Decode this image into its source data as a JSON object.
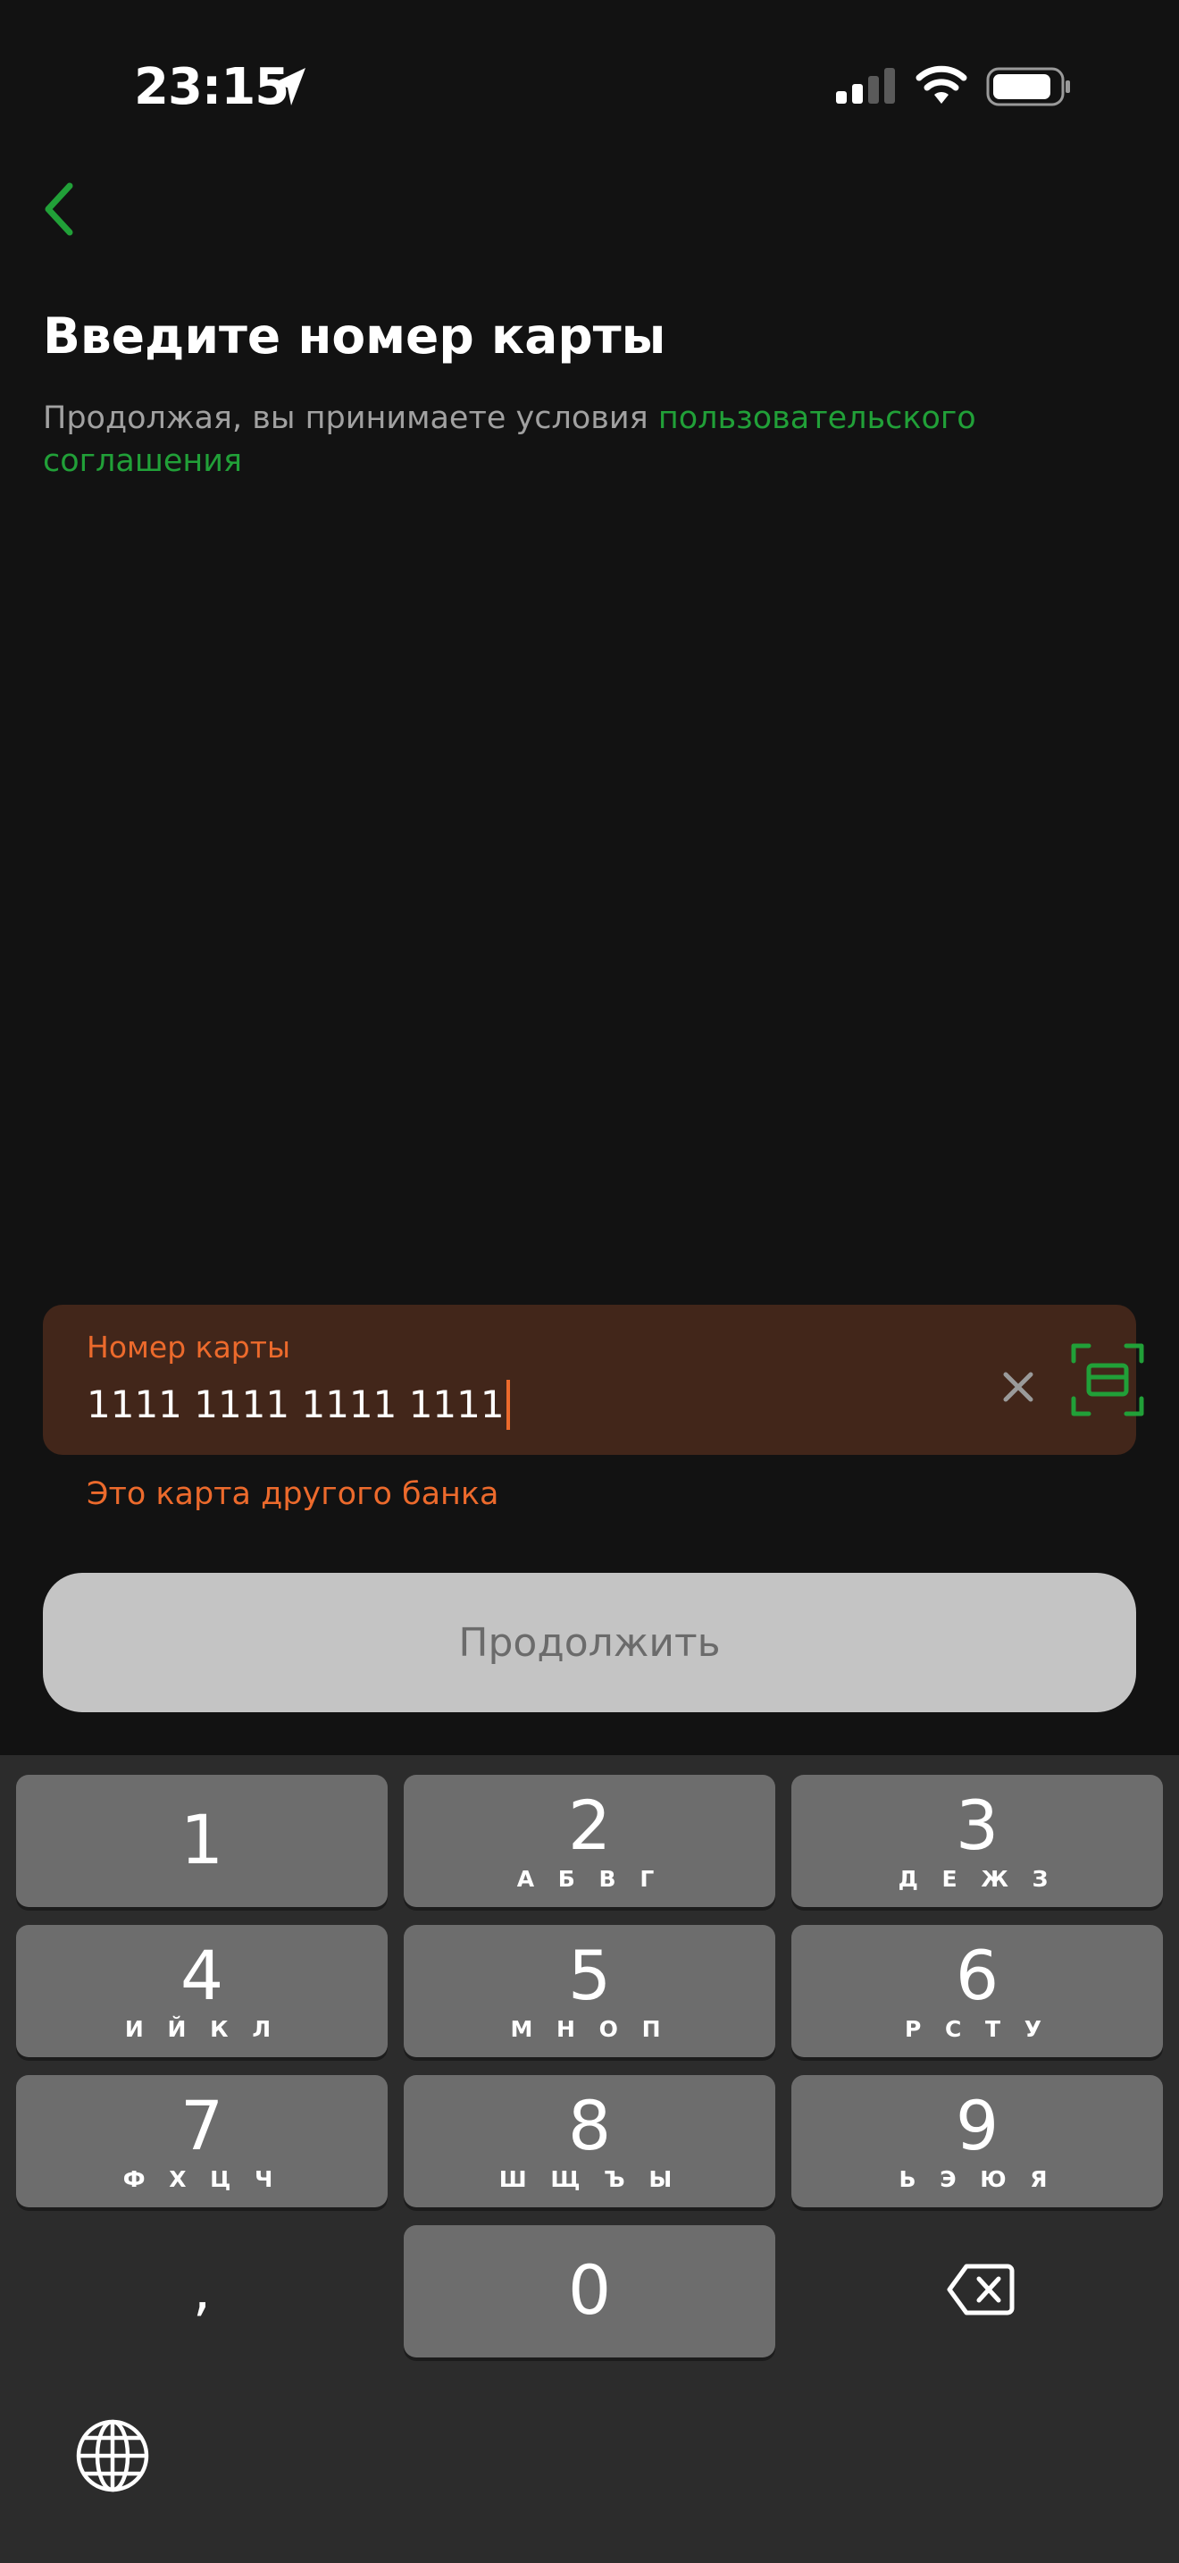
{
  "status_bar": {
    "time": "23:15",
    "icons": [
      "location-arrow-icon",
      "cellular-signal-icon",
      "wifi-icon",
      "battery-icon"
    ]
  },
  "header": {
    "back_icon": "chevron-left-icon",
    "title": "Введите номер карты"
  },
  "agreement": {
    "text": "Продолжая, вы принимаете условия ",
    "link": "пользовательского соглашения"
  },
  "card_input": {
    "label": "Номер карты",
    "value": "1111 1111 1111 1111",
    "error": "Это карта другого банка",
    "clear_icon": "close-icon",
    "scan_icon": "card-scan-icon"
  },
  "continue_button": {
    "label": "Продолжить"
  },
  "keyboard": {
    "keys": [
      {
        "digit": "1",
        "letters": ""
      },
      {
        "digit": "2",
        "letters": "А Б В Г"
      },
      {
        "digit": "3",
        "letters": "Д Е Ж З"
      },
      {
        "digit": "4",
        "letters": "И Й К Л"
      },
      {
        "digit": "5",
        "letters": "М Н О П"
      },
      {
        "digit": "6",
        "letters": "Р С Т У"
      },
      {
        "digit": "7",
        "letters": "Ф Х Ц Ч"
      },
      {
        "digit": "8",
        "letters": "Ш Щ Ъ Ы"
      },
      {
        "digit": "9",
        "letters": "Ь Э Ю Я"
      },
      {
        "digit": "0",
        "letters": ""
      }
    ],
    "comma": ",",
    "backspace_icon": "backspace-icon",
    "globe_icon": "globe-icon"
  },
  "colors": {
    "background": "#121212",
    "accent_green": "#21a038",
    "error_orange": "#ec6a2c",
    "field_background": "#42261a",
    "button_disabled": "#c4c4c4",
    "keyboard_background": "#2c2c2c",
    "key_background": "#6d6d6d"
  }
}
